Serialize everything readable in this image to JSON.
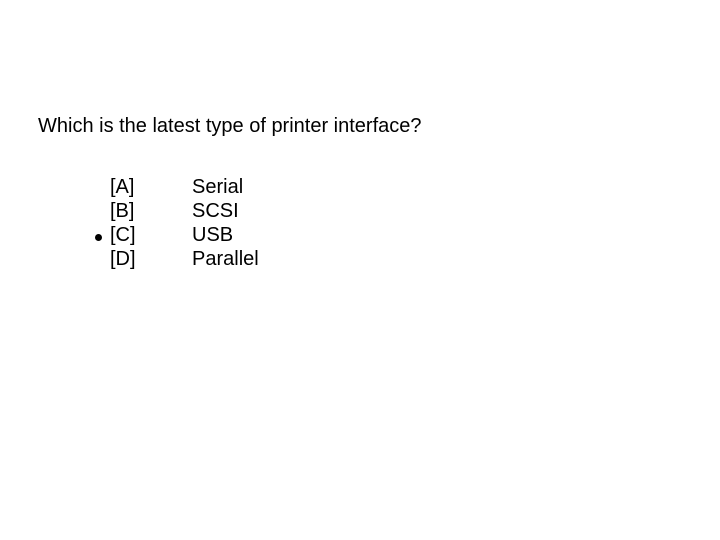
{
  "question": "Which is the latest type of printer interface?",
  "options": [
    {
      "label": "[A]",
      "text": "Serial",
      "selected": false
    },
    {
      "label": "[B]",
      "text": "SCSI",
      "selected": false
    },
    {
      "label": "[C]",
      "text": "USB",
      "selected": true
    },
    {
      "label": "[D]",
      "text": "Parallel",
      "selected": false
    }
  ]
}
